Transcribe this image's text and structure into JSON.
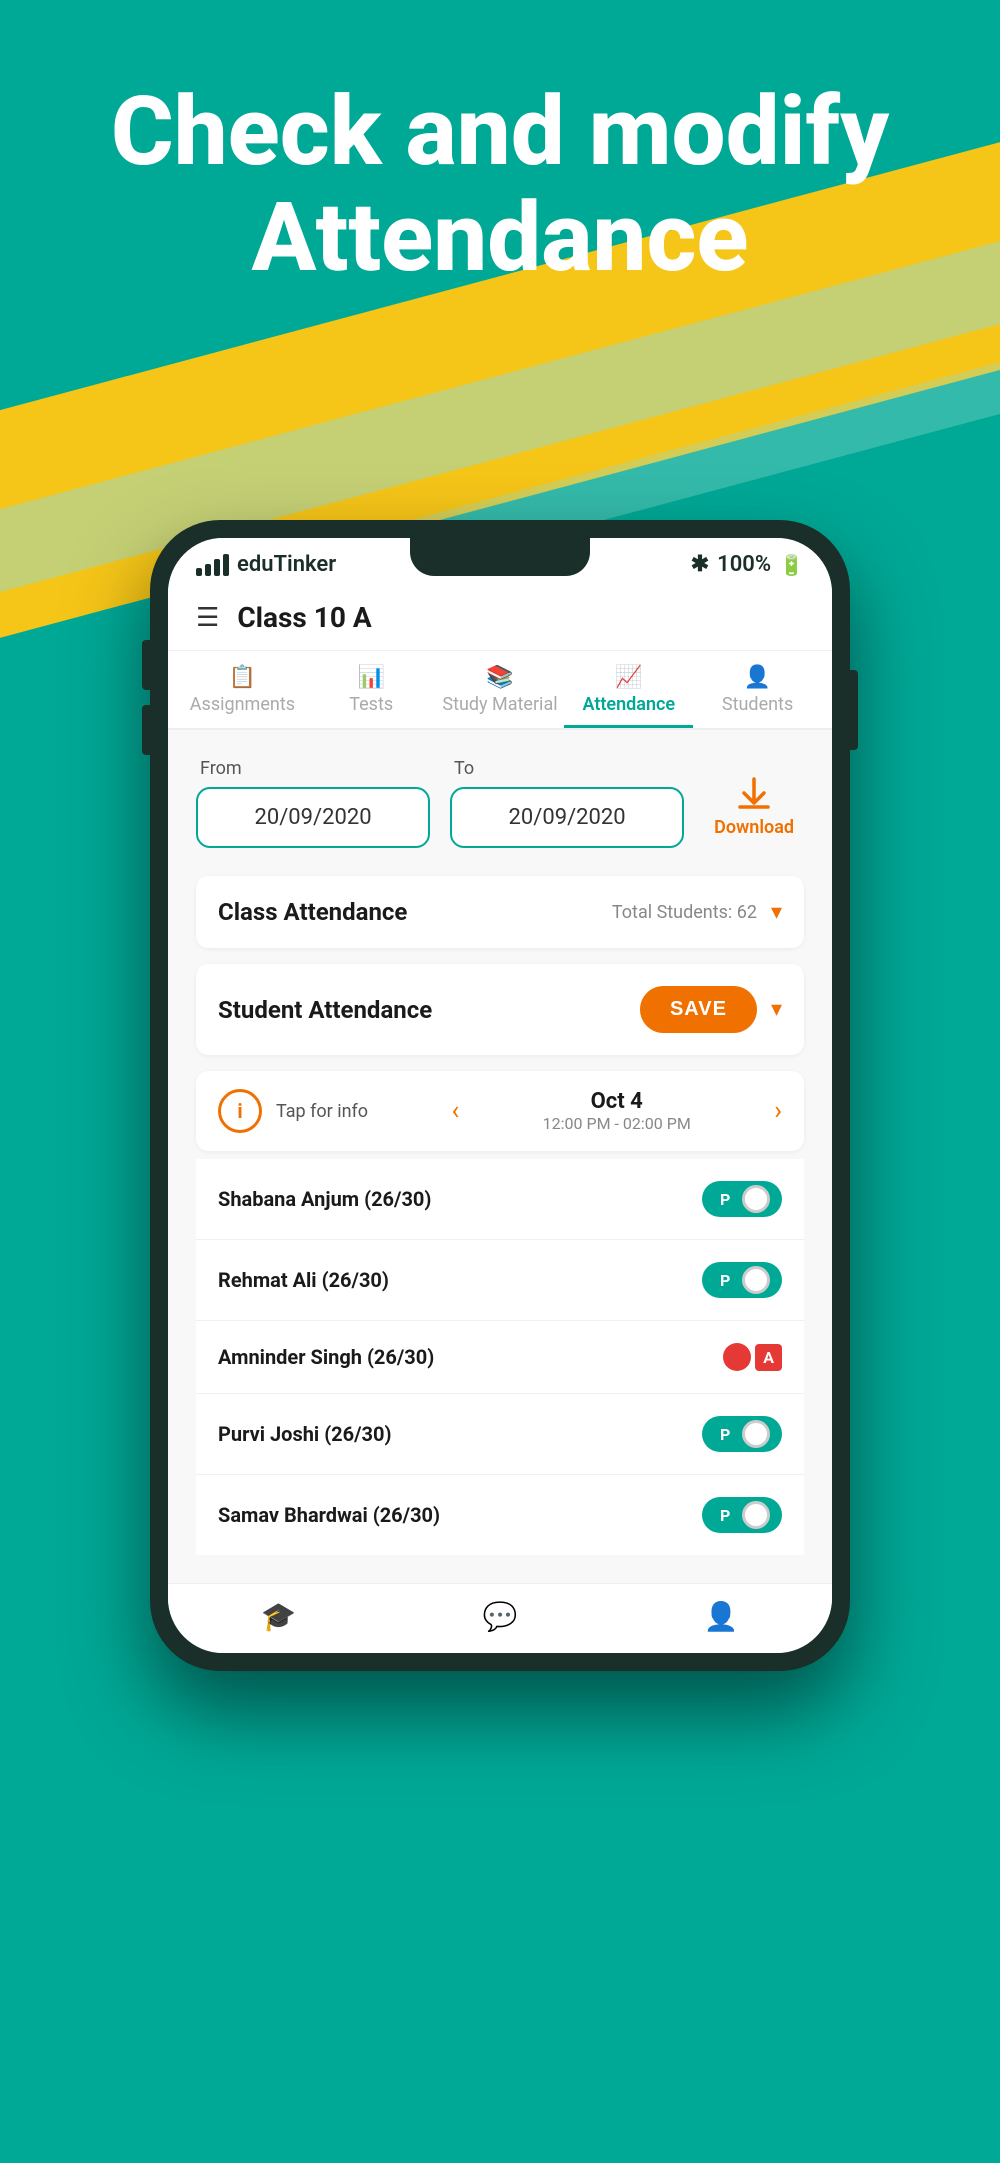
{
  "hero": {
    "line1": "Check and modify",
    "line2": "Attendance"
  },
  "status_bar": {
    "carrier": "eduTinker",
    "bluetooth": "✱",
    "battery": "100%"
  },
  "header": {
    "title": "Class 10 A"
  },
  "tabs": [
    {
      "id": "assignments",
      "label": "Assignments",
      "icon": "📋",
      "active": false
    },
    {
      "id": "tests",
      "label": "Tests",
      "icon": "📊",
      "active": false
    },
    {
      "id": "study-material",
      "label": "Study Material",
      "icon": "📚",
      "active": false
    },
    {
      "id": "attendance",
      "label": "Attendance",
      "icon": "📈",
      "active": true
    },
    {
      "id": "students",
      "label": "Students",
      "icon": "👤",
      "active": false
    }
  ],
  "date_filter": {
    "from_label": "From",
    "to_label": "To",
    "from_value": "20/09/2020",
    "to_value": "20/09/2020",
    "download_label": "Download"
  },
  "class_attendance": {
    "title": "Class Attendance",
    "sub": "Total Students: 62"
  },
  "student_attendance": {
    "title": "Student Attendance",
    "save_label": "SAVE"
  },
  "session": {
    "date": "Oct 4",
    "time": "12:00 PM - 02:00 PM",
    "tap_info": "Tap for info"
  },
  "students": [
    {
      "name": "Shabana Anjum",
      "record": "(26/30)",
      "present": true
    },
    {
      "name": "Rehmat Ali",
      "record": "(26/30)",
      "present": true
    },
    {
      "name": "Amninder Singh",
      "record": "(26/30)",
      "present": false
    },
    {
      "name": "Purvi Joshi",
      "record": "(26/30)",
      "present": true
    },
    {
      "name": "Samav Bhardwai",
      "record": "(26/30)",
      "present": true
    }
  ],
  "bottom_nav": [
    {
      "id": "home",
      "icon": "🎓"
    },
    {
      "id": "chat",
      "icon": "💬"
    },
    {
      "id": "profile",
      "icon": "👤"
    }
  ],
  "colors": {
    "primary": "#00a896",
    "accent": "#f07000",
    "absent": "#e53935",
    "bg": "#00a896"
  }
}
